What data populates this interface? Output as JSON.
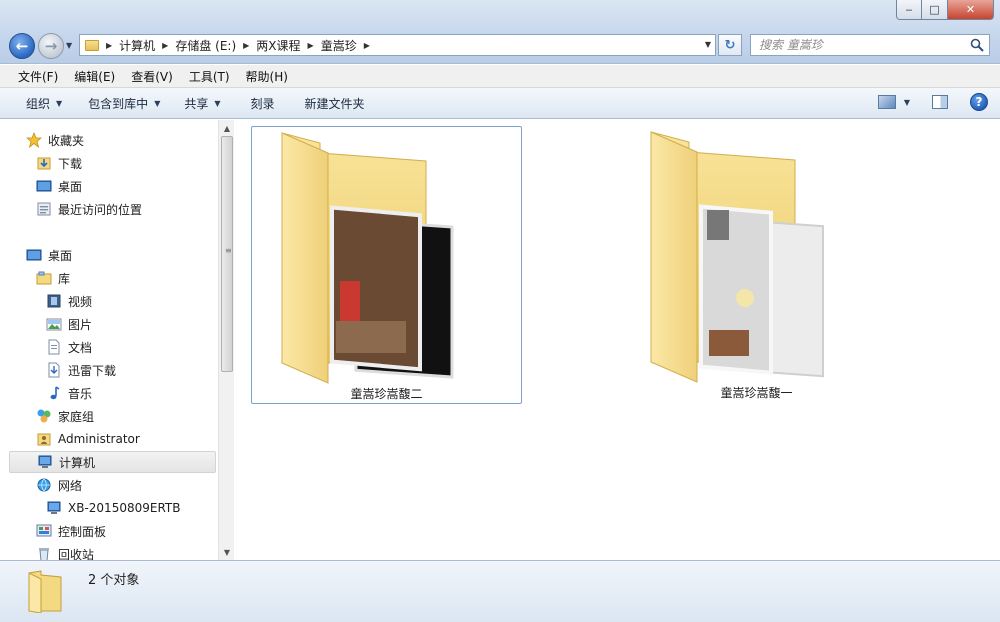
{
  "window": {
    "buttons": {
      "minimize": "‒",
      "maximize": "□",
      "close": "✕"
    }
  },
  "address": {
    "crumbs": [
      "计算机",
      "存储盘 (E:)",
      "两X课程",
      "童嵩珍"
    ]
  },
  "search": {
    "placeholder": "搜索 童嵩珍"
  },
  "menu": [
    "文件(F)",
    "编辑(E)",
    "查看(V)",
    "工具(T)",
    "帮助(H)"
  ],
  "commands": [
    {
      "label": "组织",
      "dropdown": true
    },
    {
      "label": "包含到库中",
      "dropdown": true
    },
    {
      "label": "共享",
      "dropdown": true
    },
    {
      "label": "刻录",
      "dropdown": false
    },
    {
      "label": "新建文件夹",
      "dropdown": false
    }
  ],
  "nav": {
    "favorites": {
      "label": "收藏夹",
      "icon": "star-icon"
    },
    "favorites_items": [
      {
        "label": "下载",
        "icon": "download-folder-icon"
      },
      {
        "label": "桌面",
        "icon": "desktop-icon"
      },
      {
        "label": "最近访问的位置",
        "icon": "recent-places-icon"
      }
    ],
    "desktop": {
      "label": "桌面",
      "icon": "desktop-icon"
    },
    "library": {
      "label": "库",
      "icon": "library-icon"
    },
    "library_items": [
      {
        "label": "视频",
        "icon": "video-icon"
      },
      {
        "label": "图片",
        "icon": "pictures-icon"
      },
      {
        "label": "文档",
        "icon": "documents-icon"
      },
      {
        "label": "迅雷下载",
        "icon": "thunder-download-icon"
      },
      {
        "label": "音乐",
        "icon": "music-icon"
      }
    ],
    "homegroup": {
      "label": "家庭组",
      "icon": "homegroup-icon"
    },
    "admin": {
      "label": "Administrator",
      "icon": "user-folder-icon"
    },
    "computer": {
      "label": "计算机",
      "icon": "computer-icon"
    },
    "network": {
      "label": "网络",
      "icon": "network-icon"
    },
    "network_item": {
      "label": "XB-20150809ERTB",
      "icon": "computer-icon"
    },
    "control_panel": {
      "label": "控制面板",
      "icon": "control-panel-icon"
    },
    "recycle": {
      "label": "回收站",
      "icon": "recycle-bin-icon"
    }
  },
  "files": [
    {
      "name": "童嵩珍嵩馥二",
      "selected": true
    },
    {
      "name": "童嵩珍嵩馥一",
      "selected": false
    }
  ],
  "status": {
    "text": "2 个对象"
  },
  "colors": {
    "accent": "#2a67c2",
    "folder": "#f4d983",
    "selection_border": "#7da2ce"
  }
}
